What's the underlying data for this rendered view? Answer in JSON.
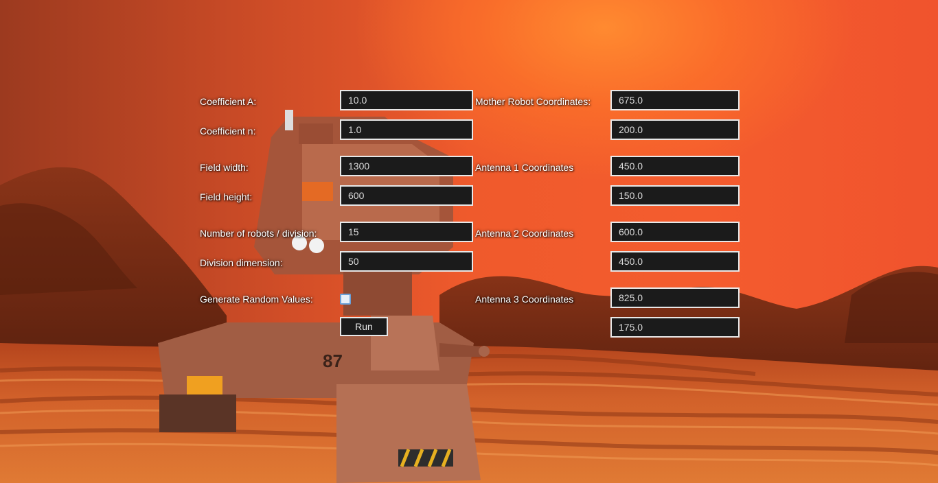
{
  "form": {
    "coefficient_a": {
      "label": "Coefficient A:",
      "value": "10.0"
    },
    "coefficient_n": {
      "label": "Coefficient n:",
      "value": "1.0"
    },
    "field_width": {
      "label": "Field width:",
      "value": "1300"
    },
    "field_height": {
      "label": "Field height:",
      "value": "600"
    },
    "robots_per_division": {
      "label": "Number of robots / division:",
      "value": "15"
    },
    "division_dimension": {
      "label": "Division dimension:",
      "value": "50"
    },
    "generate_random": {
      "label": "Generate Random Values:",
      "checked": false
    },
    "run_label": "Run",
    "mother_robot": {
      "label": "Mother Robot Coordinates:",
      "x": "675.0",
      "y": "200.0"
    },
    "antenna1": {
      "label": "Antenna 1 Coordinates",
      "x": "450.0",
      "y": "150.0"
    },
    "antenna2": {
      "label": "Antenna 2 Coordinates",
      "x": "600.0",
      "y": "450.0"
    },
    "antenna3": {
      "label": "Antenna 3 Coordinates",
      "x": "825.0",
      "y": "175.0"
    }
  }
}
